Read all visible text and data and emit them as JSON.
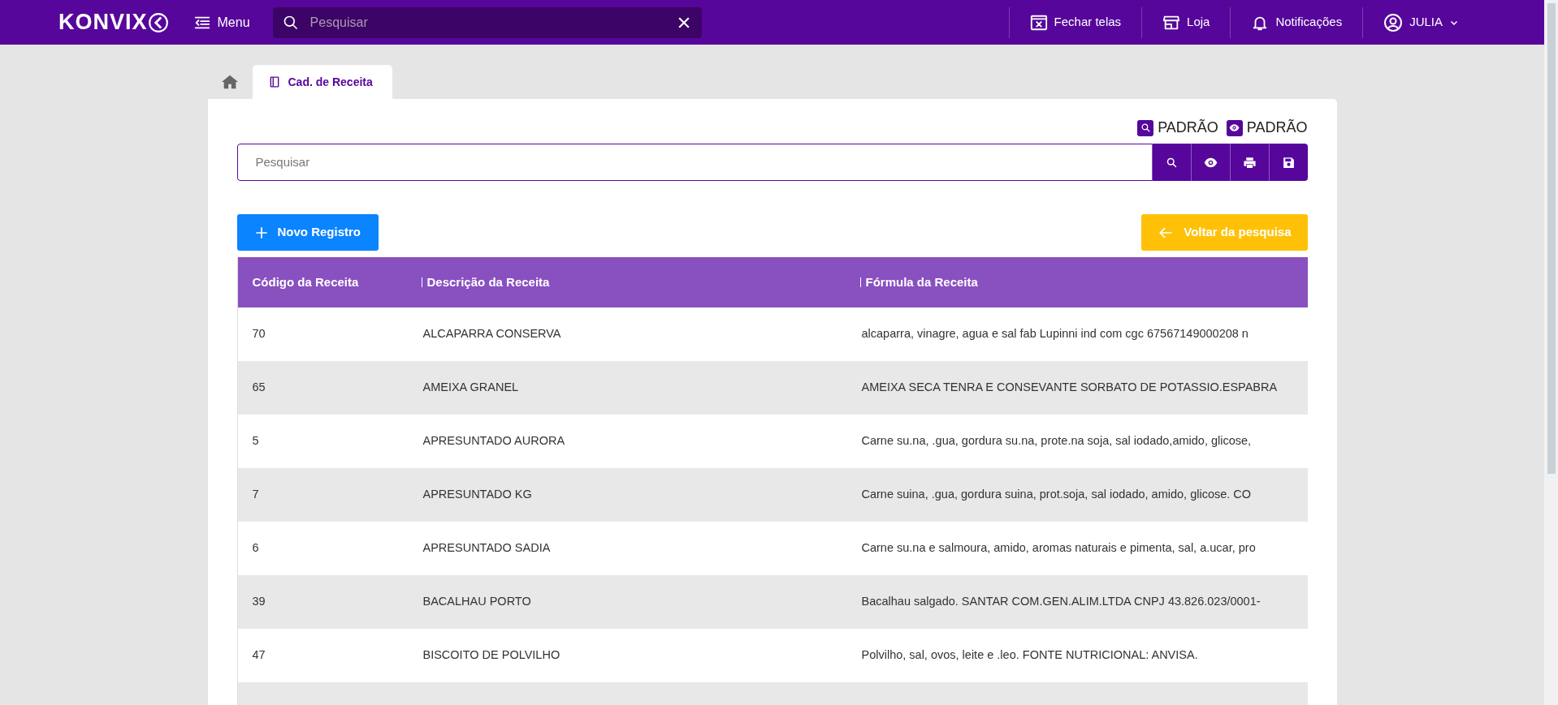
{
  "topbar": {
    "logo": "KONVIX",
    "menu_label": "Menu",
    "search": {
      "placeholder": "Pesquisar"
    },
    "actions": [
      {
        "kind": "close-windows",
        "label": "Fechar telas"
      },
      {
        "kind": "store",
        "label": "Loja"
      },
      {
        "kind": "bell",
        "label": "Notificações"
      }
    ],
    "user": "JULIA"
  },
  "tabs": [
    {
      "kind": "home",
      "selected": false
    },
    {
      "kind": "page",
      "label": "Cad. de Receita",
      "selected": true
    }
  ],
  "filters": [
    {
      "kind": "search",
      "label": "PADRÃO"
    },
    {
      "kind": "view",
      "label": "PADRÃO"
    }
  ],
  "search": {
    "placeholder": "Pesquisar"
  },
  "tools": [
    {
      "kind": "search"
    },
    {
      "kind": "view"
    },
    {
      "kind": "print"
    },
    {
      "kind": "save"
    }
  ],
  "buttons": {
    "new": "Novo Registro",
    "back": "Voltar da pesquisa"
  },
  "table": {
    "columns": [
      "Código da Receita",
      "Descrição da Receita",
      "Fórmula da Receita"
    ],
    "rows": [
      [
        "70",
        "ALCAPARRA CONSERVA",
        "alcaparra, vinagre, agua e sal fab Lupinni ind com cgc 67567149000208 n"
      ],
      [
        "65",
        "AMEIXA GRANEL",
        "AMEIXA SECA TENRA E CONSEVANTE SORBATO DE POTASSIO.ESPABRA"
      ],
      [
        "5",
        "APRESUNTADO AURORA",
        "Carne su.na, .gua, gordura su.na, prote.na soja, sal iodado,amido, glicose,"
      ],
      [
        "7",
        "APRESUNTADO KG",
        "Carne suina, .gua, gordura suina, prot.soja, sal iodado, amido, glicose. CO"
      ],
      [
        "6",
        "APRESUNTADO SADIA",
        "Carne su.na e salmoura, amido, aromas naturais e pimenta, sal, a.ucar, pro"
      ],
      [
        "39",
        "BACALHAU PORTO",
        "Bacalhau salgado. SANTAR COM.GEN.ALIM.LTDA CNPJ 43.826.023/0001-"
      ],
      [
        "47",
        "BISCOITO DE POLVILHO",
        "Polvilho, sal, ovos, leite e .leo. FONTE NUTRICIONAL: ANVISA."
      ]
    ]
  }
}
